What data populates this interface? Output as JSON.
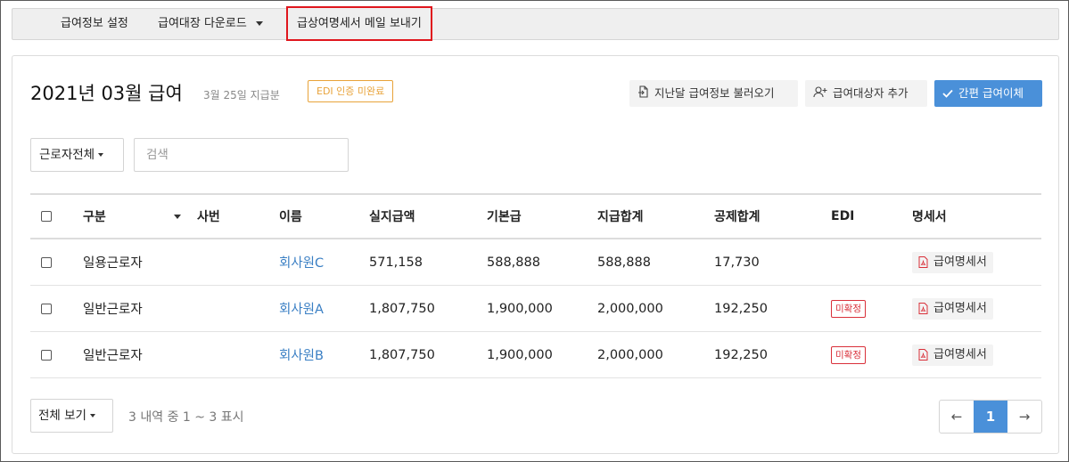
{
  "topbar": {
    "menu_salary_settings": "급여정보 설정",
    "menu_ledger_download": "급여대장 다운로드",
    "menu_send_email": "급상여명세서 메일 보내기"
  },
  "header": {
    "title": "2021년 03월 급여",
    "subtitle": "3월 25일 지급분",
    "edi_badge": "EDI 인증 미완료",
    "btn_load_prev": "지난달 급여정보 불러오기",
    "btn_add_target": "급여대상자 추가",
    "btn_quick_transfer": "간편 급여이체"
  },
  "filter": {
    "worker_select": "근로자전체",
    "search_placeholder": "검색"
  },
  "table": {
    "headers": {
      "type": "구분",
      "emp_no": "사번",
      "name": "이름",
      "net_pay": "실지급액",
      "base_pay": "기본급",
      "total_pay": "지급합계",
      "total_deduction": "공제합계",
      "edi": "EDI",
      "statement": "명세서"
    },
    "rows": [
      {
        "type": "일용근로자",
        "emp_no": "",
        "name": "회사원C",
        "net_pay": "571,158",
        "base_pay": "588,888",
        "total_pay": "588,888",
        "total_deduction": "17,730",
        "edi": "",
        "statement": "급여명세서"
      },
      {
        "type": "일반근로자",
        "emp_no": "",
        "name": "회사원A",
        "net_pay": "1,807,750",
        "base_pay": "1,900,000",
        "total_pay": "2,000,000",
        "total_deduction": "192,250",
        "edi": "미확정",
        "statement": "급여명세서"
      },
      {
        "type": "일반근로자",
        "emp_no": "",
        "name": "회사원B",
        "net_pay": "1,807,750",
        "base_pay": "1,900,000",
        "total_pay": "2,000,000",
        "total_deduction": "192,250",
        "edi": "미확정",
        "statement": "급여명세서"
      }
    ]
  },
  "footer": {
    "view_select": "전체 보기",
    "count_text": "3 내역 중 1 ~ 3 표시",
    "prev": "←",
    "page": "1",
    "next": "→"
  },
  "colors": {
    "primary": "#4a90d9",
    "link": "#3a7fc4",
    "warning": "#e8a33a",
    "danger": "#d9303a",
    "highlight_border": "#e0161d"
  }
}
